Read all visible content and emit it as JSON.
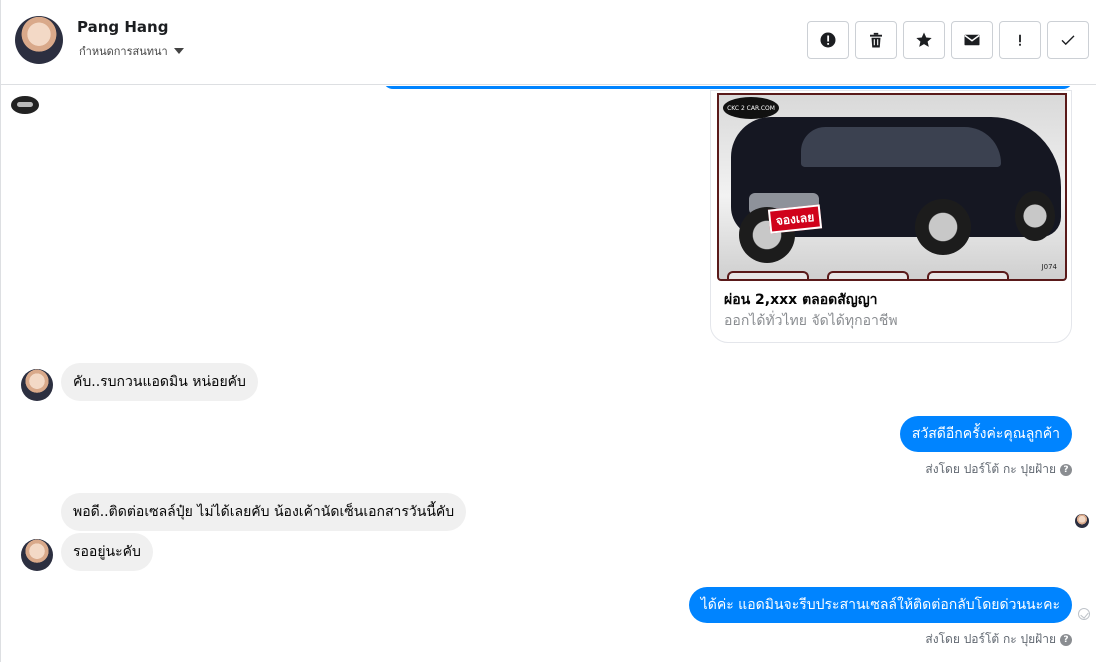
{
  "header": {
    "contact_name": "Pang Hang",
    "assign_label": "กำหนดการสนทนา"
  },
  "actions": [
    {
      "name": "alert-icon-button",
      "icon": "alert-circle-icon"
    },
    {
      "name": "delete-button",
      "icon": "trash-icon"
    },
    {
      "name": "star-button",
      "icon": "star-icon"
    },
    {
      "name": "mark-unread-button",
      "icon": "envelope-icon"
    },
    {
      "name": "spam-button",
      "icon": "exclamation-icon"
    },
    {
      "name": "mark-done-button",
      "icon": "check-icon"
    }
  ],
  "card": {
    "image_logo": "CKC 2 CAR.COM",
    "image_stamp": "จองเลย",
    "image_code": "J074",
    "title": "ผ่อน 2,xxx ตลอดสัญญา",
    "subtitle": "ออกได้ทั่วไทย จัดได้ทุกอาชีพ"
  },
  "messages": {
    "m1": "คับ..รบกวนแอดมิน หน่อยคับ",
    "m2": "สวัสดีอีกครั้งค่ะคุณลูกค้า",
    "m3": "พอดี..ติดต่อเซลล์ปุ๋ย ไม่ได้เลยคับ น้องเค้านัดเซ็นเอกสารวันนี้คับ",
    "m4": "รออยู่นะคับ",
    "m5": "ได้ค่ะ แอดมินจะรีบประสานเซลล์ให้ติดต่อกลับโดยด่วนนะคะ"
  },
  "sent_by": {
    "s1": "ส่งโดย ปอร์โต้ กะ ปุยฝ้าย",
    "s2": "ส่งโดย ปอร์โต้ กะ ปุยฝ้าย"
  },
  "colors": {
    "accent": "#0084ff",
    "incoming_bubble": "#f0f0f0"
  }
}
